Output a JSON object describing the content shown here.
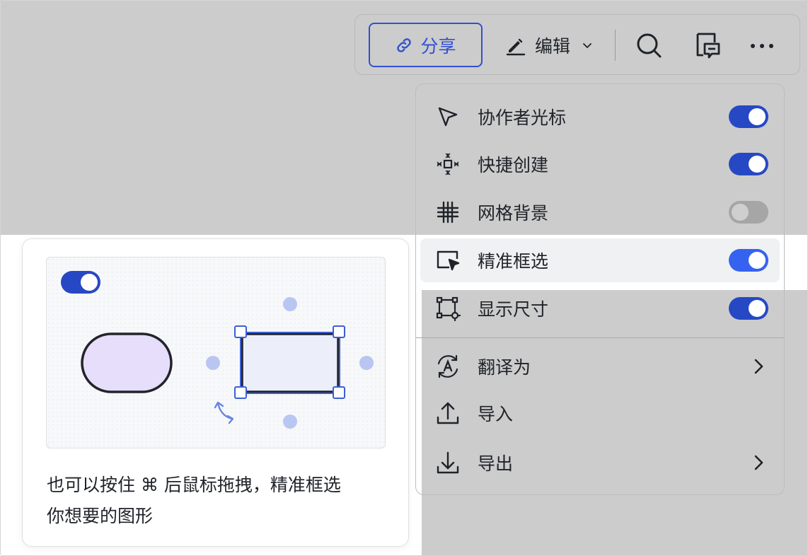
{
  "toolbar": {
    "share_label": "分享",
    "edit_label": "编辑",
    "icons": [
      "link-icon",
      "pen-icon",
      "chevron-down-icon",
      "search-icon",
      "comment-icon",
      "more-icon"
    ]
  },
  "menu": {
    "items": [
      {
        "label": "协作者光标",
        "icon": "cursor-icon",
        "toggle": "on"
      },
      {
        "label": "快捷创建",
        "icon": "quick-create-icon",
        "toggle": "on"
      },
      {
        "label": "网格背景",
        "icon": "grid-icon",
        "toggle": "off"
      },
      {
        "label": "精准框选",
        "icon": "precise-select-icon",
        "toggle": "on"
      },
      {
        "label": "显示尺寸",
        "icon": "show-size-icon",
        "toggle": "on"
      },
      {
        "label": "翻译为",
        "icon": "translate-icon",
        "submenu": true
      },
      {
        "label": "导入",
        "icon": "import-icon"
      },
      {
        "label": "导出",
        "icon": "export-icon",
        "submenu": true
      }
    ]
  },
  "tooltip": {
    "text_line1": "也可以按住 ⌘ 后鼠标拖拽，精准框选",
    "text_line2": "你想要的图形"
  },
  "colors": {
    "accent": "#2748c4",
    "accent_bright": "#3662f0",
    "overlay": "#cccccc",
    "shape_fill": "#e6defa"
  }
}
